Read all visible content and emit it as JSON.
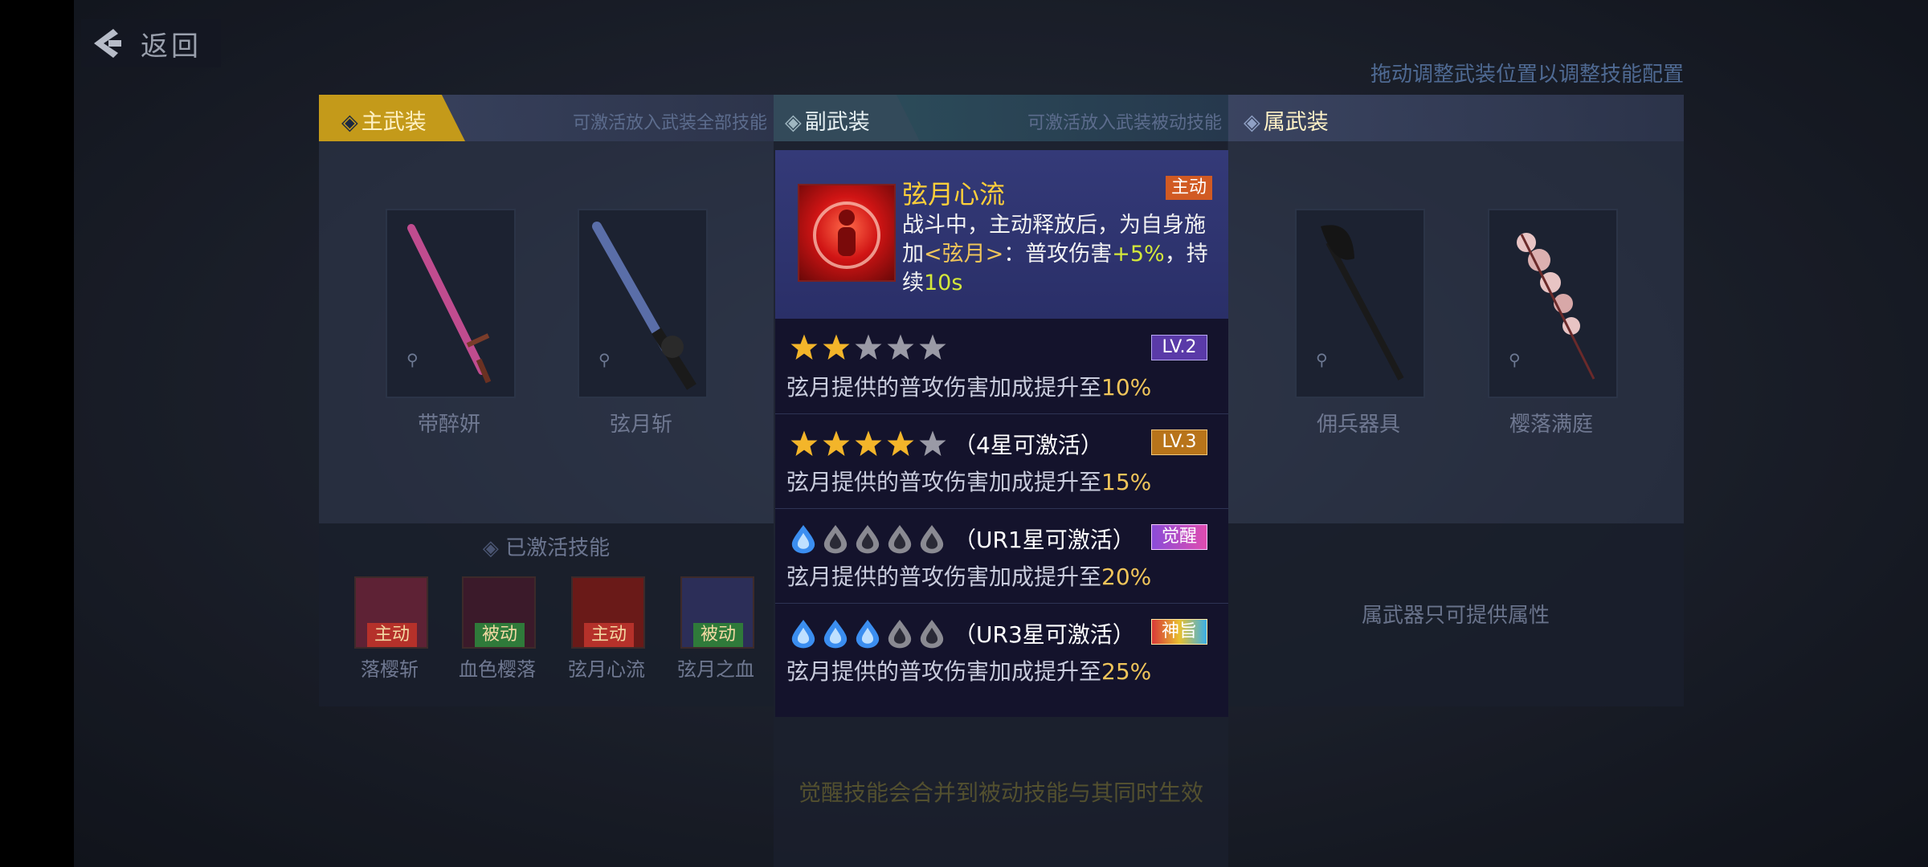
{
  "nav": {
    "back_label": "返回"
  },
  "hint_top": "拖动调整武装位置以调整技能配置",
  "main_panel": {
    "tab_label": "主武装",
    "tab_note": "可激活放入武装全部技能",
    "weapons": [
      {
        "name": "带醉妍"
      },
      {
        "name": "弦月斩"
      }
    ],
    "skills_title": "已激活技能",
    "skills": [
      {
        "name": "落樱斩",
        "tag": "主动",
        "tag_color": "#b5312a",
        "bg": "#5e2235"
      },
      {
        "name": "血色樱落",
        "tag": "被动",
        "tag_color": "#2f7a3a",
        "bg": "#3b1a2a"
      },
      {
        "name": "弦月心流",
        "tag": "主动",
        "tag_color": "#b5312a",
        "bg": "#6a1a18"
      },
      {
        "name": "弦月之血",
        "tag": "被动",
        "tag_color": "#2f7a3a",
        "bg": "#2c2e58"
      }
    ]
  },
  "sub_panel": {
    "tab_label": "副武装",
    "tab_note": "可激活放入武装被动技能"
  },
  "attr_panel": {
    "tab_label": "属武装",
    "weapons": [
      {
        "name": "佣兵器具"
      },
      {
        "name": "樱落满庭"
      }
    ],
    "note": "属武器只可提供属性"
  },
  "popup": {
    "skill_name": "弦月心流",
    "badge": "主动",
    "desc_1": "战斗中，主动释放后，为自身施加",
    "desc_tag": "<弦月>",
    "desc_2": "：普攻伤害",
    "desc_bonus": "+5%",
    "desc_3": "，持续",
    "desc_duration": "10s",
    "upgrades": [
      {
        "stars_filled": 2,
        "condition": "",
        "badge": "LV.2",
        "text": "弦月提供的普攻伤害加成提升至",
        "pct": "10%"
      },
      {
        "stars_filled": 4,
        "condition": "（4星可激活）",
        "badge": "LV.3",
        "text": "弦月提供的普攻伤害加成提升至",
        "pct": "15%"
      },
      {
        "drops_filled": 1,
        "condition": "（UR1星可激活）",
        "badge": "觉醒",
        "text": "弦月提供的普攻伤害加成提升至",
        "pct": "20%"
      },
      {
        "drops_filled": 3,
        "condition": "（UR3星可激活）",
        "badge": "神旨",
        "text": "弦月提供的普攻伤害加成提升至",
        "pct": "25%"
      }
    ]
  },
  "bottom_hint": "觉醒技能会合并到被动技能与其同时生效"
}
